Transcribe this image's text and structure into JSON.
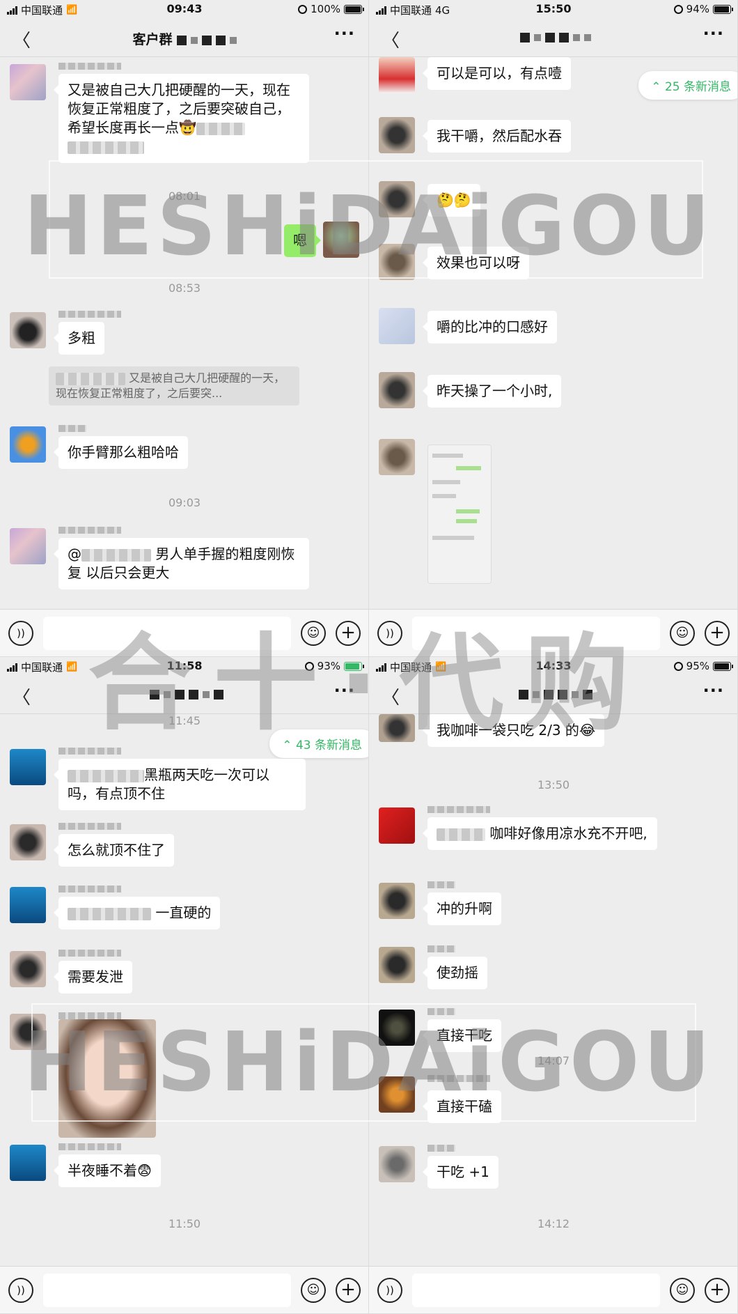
{
  "panels": {
    "tl": {
      "status": {
        "carrier": "中国联通",
        "time": "09:43",
        "battery": "100%"
      },
      "title": "客户群",
      "messages": [
        {
          "text": "又是被自己大几把硬醒的一天，现在恢复正常粗度了，之后要突破自己，希望长度再长一点🤠"
        },
        {
          "time": "08:01"
        },
        {
          "text": "嗯",
          "mine": true
        },
        {
          "time": "08:53"
        },
        {
          "text": "多粗"
        },
        {
          "quote": "又是被自己大几把硬醒的一天，现在恢复正常粗度了，之后要突..."
        },
        {
          "text": "你手臂那么粗哈哈"
        },
        {
          "time": "09:03"
        },
        {
          "text": "男人单手握的粗度刚恢复 以后只会更大",
          "prefix": "@"
        }
      ]
    },
    "tr": {
      "status": {
        "carrier": "中国联通",
        "network": "4G",
        "time": "15:50",
        "battery": "94%"
      },
      "new_messages": "25 条新消息",
      "messages": [
        {
          "text": "可以是可以，有点噎"
        },
        {
          "text": "我干嚼，然后配水吞"
        },
        {
          "text": "🤔🤔"
        },
        {
          "text": "效果也可以呀"
        },
        {
          "text": "嚼的比冲的口感好"
        },
        {
          "text": "昨天操了一个小时,"
        }
      ]
    },
    "bl": {
      "status": {
        "carrier": "中国联通",
        "time": "11:58",
        "battery": "93%"
      },
      "top_time": "11:45",
      "new_messages": "43 条新消息",
      "messages": [
        {
          "text": "黑瓶两天吃一次可以吗，有点顶不住"
        },
        {
          "text": "怎么就顶不住了"
        },
        {
          "text": "一直硬的"
        },
        {
          "text": "需要发泄"
        },
        {
          "text": "半夜睡不着😨"
        },
        {
          "time": "11:50"
        }
      ]
    },
    "br": {
      "status": {
        "carrier": "中国联通",
        "time": "14:33",
        "battery": "95%"
      },
      "messages": [
        {
          "text": "我咖啡一袋只吃 2/3 的😂"
        },
        {
          "time": "13:50"
        },
        {
          "text": "咖啡好像用凉水充不开吧,"
        },
        {
          "text": "冲的升啊"
        },
        {
          "text": "使劲摇"
        },
        {
          "text": "直接干吃"
        },
        {
          "time": "14:07"
        },
        {
          "text": "直接干磕"
        },
        {
          "text": "干吃 +1"
        },
        {
          "time": "14:12"
        }
      ]
    }
  },
  "watermark": {
    "latin": "HESHiDAiGOU",
    "chinese": "合十·代购"
  },
  "icons": {
    "back": "back-chevron-icon",
    "more": "more-dots-icon",
    "voice": "voice-icon",
    "emoji": "emoji-icon",
    "plus": "plus-icon"
  },
  "colors": {
    "bg": "#ededed",
    "bubble_in": "#ffffff",
    "bubble_out": "#95ec69",
    "accent": "#34b865"
  }
}
